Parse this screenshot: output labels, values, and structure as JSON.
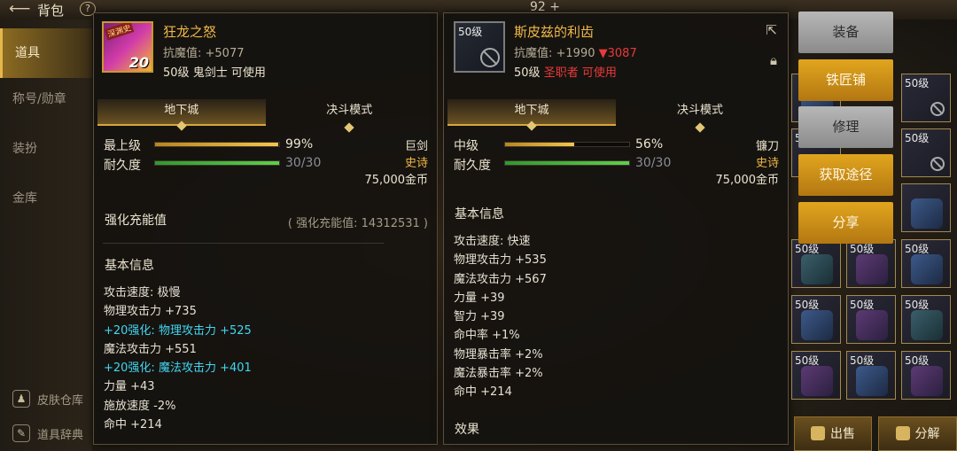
{
  "topbar": {
    "back_icon": "arrow-left-icon",
    "title": "背包",
    "help": "?",
    "number": "92 +"
  },
  "nav": {
    "items": [
      {
        "label": "道具",
        "active": true
      },
      {
        "label": "称号/勋章",
        "active": false
      },
      {
        "label": "装扮",
        "active": false
      },
      {
        "label": "金库",
        "active": false
      }
    ],
    "bottom": [
      {
        "label": "皮肤仓库",
        "icon": "skin-icon"
      },
      {
        "label": "道具辞典",
        "icon": "book-icon"
      }
    ]
  },
  "left_item": {
    "icon_tag": "深渊史",
    "icon_level": "20",
    "name": "狂龙之怒",
    "resistance": "抗魔值: +5077",
    "meta_level": "50级",
    "meta_class": "鬼剑士",
    "meta_usable": "可使用",
    "tabs": [
      "地下城",
      "决斗模式"
    ],
    "grade_label": "最上级",
    "grade_percent": 99,
    "grade_text": "99%",
    "durability_label": "耐久度",
    "durability_text": "30/30",
    "durability_fraction": 1.0,
    "weapon_type": "巨剑",
    "rarity": "史诗",
    "price": "75,000金币",
    "enhance_title": "强化充能值",
    "enhance_value": "( 强化充能值: 14312531 )",
    "basic_title": "基本信息",
    "attributes": [
      {
        "text": "攻击速度: 极慢",
        "color": "normal"
      },
      {
        "text": "物理攻击力 +735",
        "color": "normal"
      },
      {
        "text": "+20强化: 物理攻击力 +525",
        "color": "cyan"
      },
      {
        "text": "魔法攻击力 +551",
        "color": "normal"
      },
      {
        "text": "+20强化: 魔法攻击力 +401",
        "color": "cyan"
      },
      {
        "text": "力量 +43",
        "color": "normal"
      },
      {
        "text": "施放速度 -2%",
        "color": "normal"
      },
      {
        "text": "命中 +214",
        "color": "normal"
      }
    ]
  },
  "right_item": {
    "icon_level": "50级",
    "name": "斯皮兹的利齿",
    "resistance_prefix": "抗魔值: +1990",
    "resistance_diff": "▼3087",
    "meta_level": "50级",
    "meta_class": "圣职者",
    "meta_usable": "可使用",
    "share_icon": "share-icon",
    "lock_icon": "lock-icon",
    "tabs": [
      "地下城",
      "决斗模式"
    ],
    "grade_label": "中级",
    "grade_percent": 56,
    "grade_text": "56%",
    "durability_label": "耐久度",
    "durability_text": "30/30",
    "durability_fraction": 1.0,
    "weapon_type": "镰刀",
    "rarity": "史诗",
    "price": "75,000金币",
    "basic_title": "基本信息",
    "attributes": [
      "攻击速度: 快速",
      "物理攻击力 +535",
      "魔法攻击力 +567",
      "力量 +39",
      "智力 +39",
      "命中率 +1%",
      "物理暴击率 +2%",
      "魔法暴击率 +2%",
      "命中 +214"
    ],
    "effect_title": "效果"
  },
  "actions": [
    "装备",
    "铁匠铺",
    "修理",
    "获取途径",
    "分享"
  ],
  "inventory_level": "50级",
  "bottom_buttons": [
    {
      "label": "出售",
      "icon": "coins-icon"
    },
    {
      "label": "分解",
      "icon": "disassemble-icon"
    }
  ]
}
